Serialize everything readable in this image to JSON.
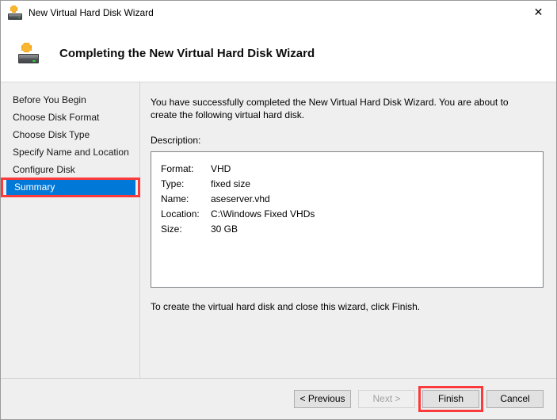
{
  "window": {
    "title": "New Virtual Hard Disk Wizard",
    "icon": "new-virtual-hard-disk-icon",
    "close_label": "✕"
  },
  "header": {
    "title": "Completing the New Virtual Hard Disk Wizard",
    "icon": "new-virtual-hard-disk-icon"
  },
  "sidebar": {
    "items": [
      {
        "label": "Before You Begin",
        "selected": false,
        "highlighted": false
      },
      {
        "label": "Choose Disk Format",
        "selected": false,
        "highlighted": false
      },
      {
        "label": "Choose Disk Type",
        "selected": false,
        "highlighted": false
      },
      {
        "label": "Specify Name and Location",
        "selected": false,
        "highlighted": false
      },
      {
        "label": "Configure Disk",
        "selected": false,
        "highlighted": false
      },
      {
        "label": "Summary",
        "selected": true,
        "highlighted": true
      }
    ]
  },
  "content": {
    "intro": "You have successfully completed the New Virtual Hard Disk Wizard. You are about to create the following virtual hard disk.",
    "description_label": "Description:",
    "description_rows": [
      {
        "key": "Format:",
        "value": "VHD"
      },
      {
        "key": "Type:",
        "value": "fixed size"
      },
      {
        "key": "Name:",
        "value": "aseserver.vhd"
      },
      {
        "key": "Location:",
        "value": "C:\\Windows Fixed VHDs"
      },
      {
        "key": "Size:",
        "value": "30 GB"
      }
    ],
    "outro": "To create the virtual hard disk and close this wizard, click Finish."
  },
  "footer": {
    "buttons": [
      {
        "label": "< Previous",
        "disabled": false,
        "highlighted": false
      },
      {
        "label": "Next >",
        "disabled": true,
        "highlighted": false
      },
      {
        "label": "Finish",
        "disabled": false,
        "highlighted": true
      },
      {
        "label": "Cancel",
        "disabled": false,
        "highlighted": false
      }
    ]
  },
  "colors": {
    "accent_blue": "#0078d7",
    "annotation_red": "#fb3b3b",
    "body_background": "#efeff0"
  }
}
